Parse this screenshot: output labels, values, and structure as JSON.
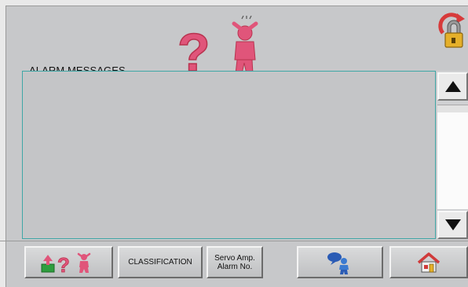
{
  "screen": {
    "title": "ALARM MESSAGES"
  },
  "icons": {
    "header_help": "alarm-help-icon",
    "lock": "lock-reset-icon",
    "scroll_up": "arrow-up-icon",
    "scroll_down": "arrow-down-icon",
    "help": "help-person-icon",
    "operator": "operator-chat-icon",
    "home": "home-icon"
  },
  "footer": {
    "classification_label": "CLASSIFICATION",
    "servo_line1": "Servo Amp.",
    "servo_line2": "Alarm No."
  },
  "colors": {
    "panel": "#c7c8ca",
    "message_border": "#3fa7a6",
    "question_mark": "#e0557a"
  }
}
